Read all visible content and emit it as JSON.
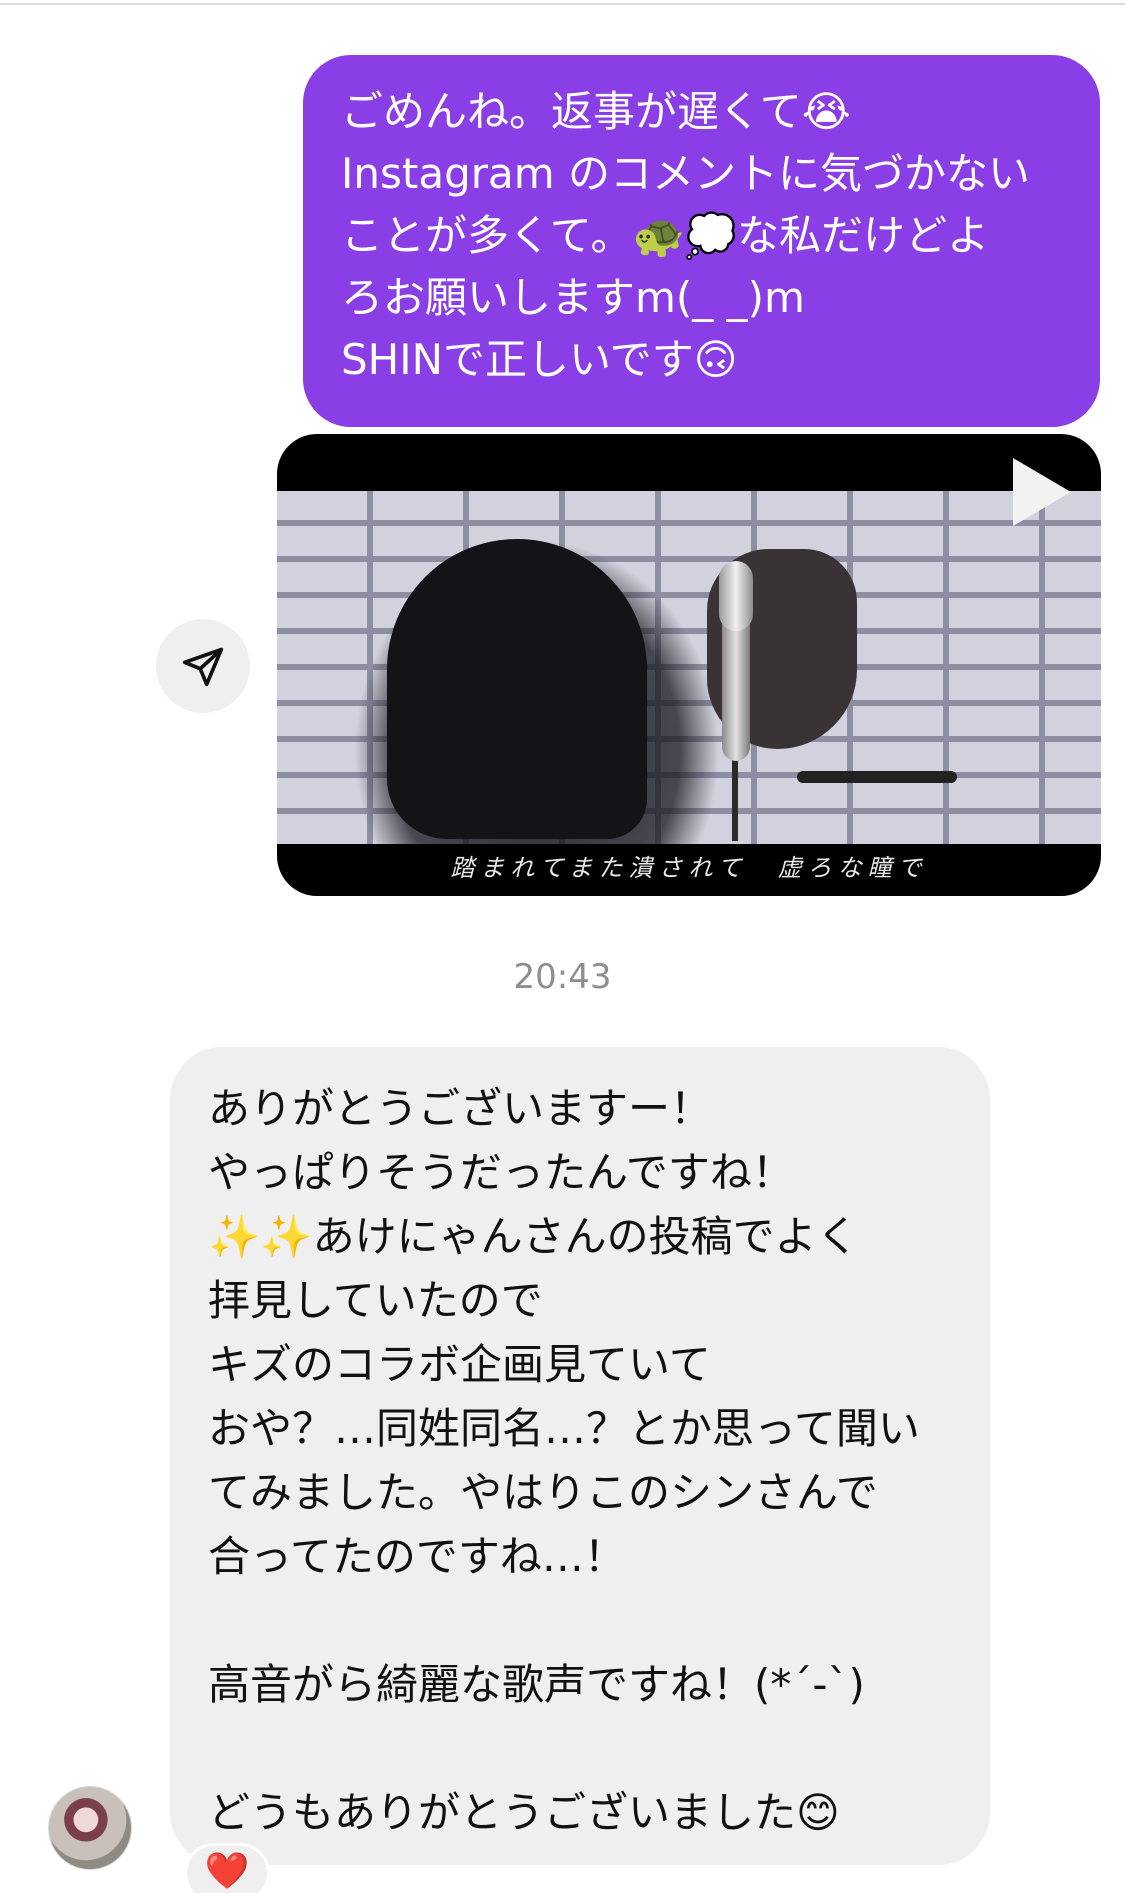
{
  "outgoing_message": {
    "lines": [
      "ごめんね。返事が遅くて😭",
      "Instagram のコメントに気づかない",
      "ことが多くて。🐢💭な私だけどよ",
      "ろお願いしますm(_ _)m",
      "SHINで正しいです🙃"
    ]
  },
  "video_message": {
    "subtitle": "踏まれてまた潰されて　虚ろな瞳で",
    "play_icon": "play-icon"
  },
  "share_button": {
    "icon": "paper-plane-icon"
  },
  "timestamp": "20:43",
  "incoming_message": {
    "lines": [
      "ありがとうございますー！",
      "やっぱりそうだったんですね！",
      "✨✨あけにゃんさんの投稿でよく",
      "拝見していたので",
      "キズのコラボ企画見ていて",
      "おや？…同姓同名…？とか思って聞い",
      "てみました。やはりこのシンさんで",
      "合ってたのですね…！",
      "",
      "高音がら綺麗な歌声ですね！(*´-`)",
      "",
      "どうもありがとうございました😊"
    ]
  },
  "reaction": "❤️",
  "colors": {
    "outgoing_bubble": "#8a3fe6",
    "incoming_bubble": "#efefef",
    "timestamp": "#8e8e8e"
  }
}
